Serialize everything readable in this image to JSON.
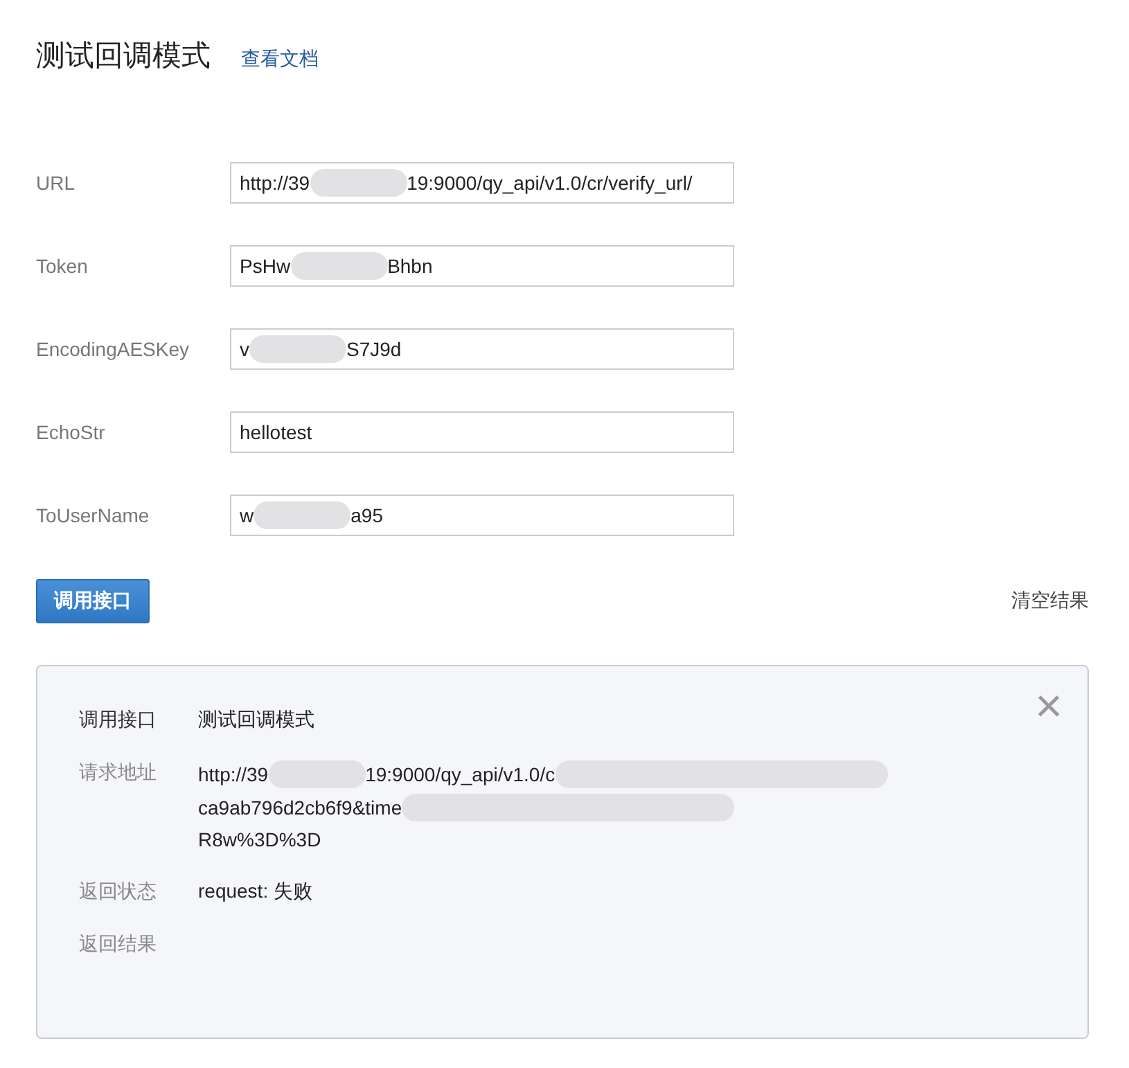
{
  "header": {
    "title": "测试回调模式",
    "doc_link": "查看文档"
  },
  "fields": [
    {
      "label": "URL",
      "value_parts": [
        "http://39",
        "19:9000/qy_api/v1.0/cr/verify_url/"
      ]
    },
    {
      "label": "Token",
      "value_parts": [
        "PsHw",
        "Bhbn"
      ]
    },
    {
      "label": "EncodingAESKey",
      "value_parts": [
        "v",
        "S7J9d"
      ]
    },
    {
      "label": "EchoStr",
      "value_parts": [
        "hellotest"
      ]
    },
    {
      "label": "ToUserName",
      "value_parts": [
        "w",
        "a95"
      ]
    }
  ],
  "call_button": "调用接口",
  "clear_link": "清空结果",
  "result": {
    "close": "×",
    "rows": [
      {
        "label": "调用接口",
        "label_dark": true,
        "lines": [
          {
            "parts": [
              "测试回调模式"
            ],
            "blur_after": false
          }
        ]
      },
      {
        "label": "请求地址",
        "label_dark": false,
        "lines": [
          {
            "parts": [
              "http://39",
              "19:9000/qy_api/v1.0/c"
            ],
            "blur_after": true
          },
          {
            "parts": [
              "ca9ab796d2cb6f9&time"
            ],
            "blur_after": true
          },
          {
            "parts": [
              "R8w%3D%3D"
            ],
            "blur_after": false
          }
        ]
      },
      {
        "label": "返回状态",
        "label_dark": false,
        "lines": [
          {
            "parts": [
              "request: 失败"
            ],
            "blur_after": false
          }
        ]
      },
      {
        "label": "返回结果",
        "label_dark": false,
        "lines": []
      }
    ]
  }
}
